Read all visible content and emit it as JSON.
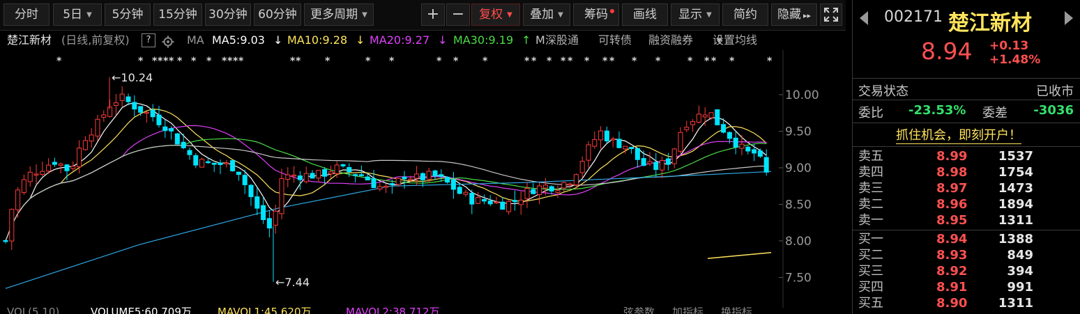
{
  "toolbar": {
    "fenshi": "分时",
    "period_5day": "5日",
    "min5": "5分钟",
    "min15": "15分钟",
    "min30": "30分钟",
    "min60": "60分钟",
    "more_periods": "更多周期",
    "zoom_in": "+",
    "zoom_out": "−",
    "fuquan": "复权",
    "overlay": "叠加",
    "chips": "筹码",
    "draw_line": "画线",
    "display": "显示",
    "simple": "简约",
    "hide": "隐藏",
    "hide_arrow": "▸▸"
  },
  "legend": {
    "stock": "楚江新材",
    "mode": "(日线,前复权)",
    "help": "?",
    "ma_label": "MA",
    "ma5": "MA5:9.03",
    "ma5_arrow": "↓",
    "ma10": "MA10:9.28",
    "ma10_arrow": "↓",
    "ma20": "MA20:9.27",
    "ma20_arrow": "↓",
    "ma30": "MA30:9.19",
    "ma30_arrow": "↑",
    "m": "M",
    "sg": "深股通",
    "kzz": "可转债",
    "rzrq": "融资融券",
    "set_ma": "设置均线"
  },
  "colors": {
    "up": "#ff3b3b",
    "down": "#00e5ff",
    "ma5": "#ffffff",
    "ma10": "#ffe45c",
    "ma20": "#e040fb",
    "ma30": "#4cdc46",
    "ma60": "#c8c8c8",
    "ma120": "#2ea8e6"
  },
  "chart": {
    "y_ticks": [
      "10.00",
      "9.50",
      "9.00",
      "8.50",
      "8.00",
      "7.50"
    ],
    "y_tick_values": [
      10.0,
      9.5,
      9.0,
      8.5,
      8.0,
      7.5
    ],
    "high_label": "10.24",
    "low_label": "7.44",
    "markers": "*",
    "arrow": "←"
  },
  "volume_strip": {
    "label": "VOL(5,10)",
    "vol5": "VOLUME5:60.709万",
    "vol10": "MAVOL1:45.620万",
    "vol20": "MAVOL2:38.712万",
    "r1": "弦参数",
    "r2": "加指标",
    "r3": "换指标"
  },
  "quote": {
    "code": "002171",
    "name": "楚江新材",
    "price": "8.94",
    "change": "+0.13",
    "change_pct": "+1.48%",
    "status_label": "交易状态",
    "status_value": "已收市",
    "weibi_label": "委比",
    "weibi_value": "-23.53%",
    "weicha_label": "委差",
    "weicha_value": "-3036",
    "ad": "抓住机会，即刻开户！",
    "sell": [
      {
        "label": "卖五",
        "price": "8.99",
        "vol": "1537"
      },
      {
        "label": "卖四",
        "price": "8.98",
        "vol": "1754"
      },
      {
        "label": "卖三",
        "price": "8.97",
        "vol": "1473"
      },
      {
        "label": "卖二",
        "price": "8.96",
        "vol": "1894"
      },
      {
        "label": "卖一",
        "price": "8.95",
        "vol": "1311"
      }
    ],
    "buy": [
      {
        "label": "买一",
        "price": "8.94",
        "vol": "1388"
      },
      {
        "label": "买二",
        "price": "8.93",
        "vol": "849"
      },
      {
        "label": "买三",
        "price": "8.92",
        "vol": "394"
      },
      {
        "label": "买四",
        "price": "8.91",
        "vol": "991"
      },
      {
        "label": "买五",
        "price": "8.90",
        "vol": "1311"
      }
    ]
  }
}
